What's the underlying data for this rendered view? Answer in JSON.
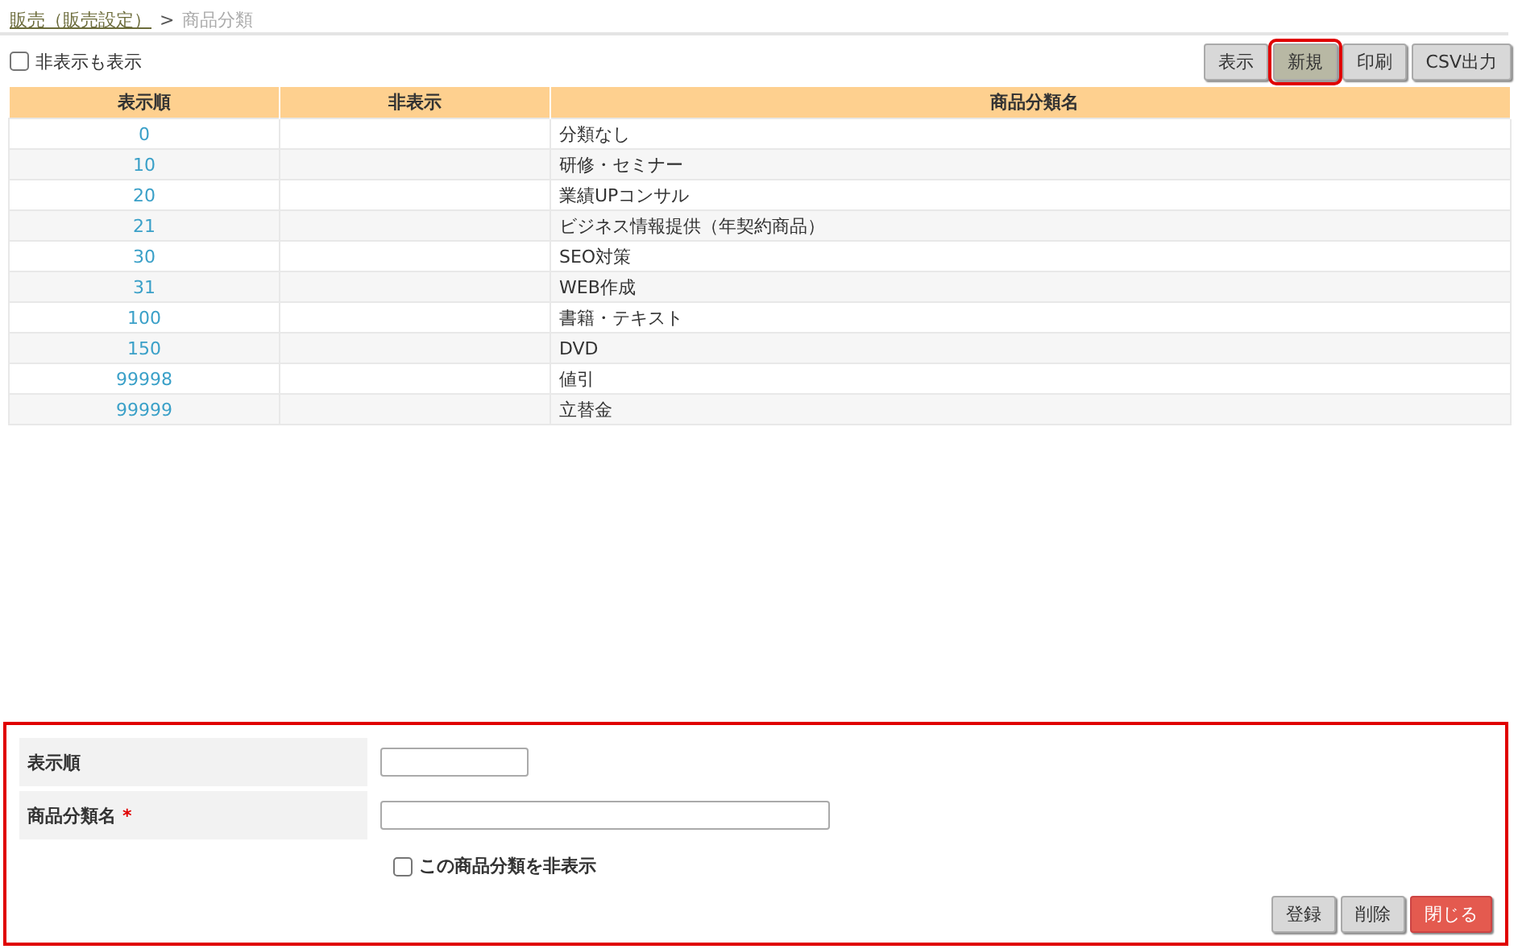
{
  "breadcrumb": {
    "parent": "販売（販売設定）",
    "separator": ">",
    "current": "商品分類"
  },
  "show_hidden": {
    "label": "非表示も表示",
    "checked": false
  },
  "toolbar": [
    {
      "label": "表示",
      "highlighted": false
    },
    {
      "label": "新規",
      "highlighted": true
    },
    {
      "label": "印刷",
      "highlighted": false
    },
    {
      "label": "CSV出力",
      "highlighted": false
    }
  ],
  "table": {
    "columns": [
      "表示順",
      "非表示",
      "商品分類名"
    ],
    "rows": [
      {
        "order": "0",
        "name": "分類なし"
      },
      {
        "order": "10",
        "name": "研修・セミナー"
      },
      {
        "order": "20",
        "name": "業績UPコンサル"
      },
      {
        "order": "21",
        "name": "ビジネス情報提供（年契約商品）"
      },
      {
        "order": "30",
        "name": "SEO対策"
      },
      {
        "order": "31",
        "name": "WEB作成"
      },
      {
        "order": "100",
        "name": "書籍・テキスト"
      },
      {
        "order": "150",
        "name": "DVD"
      },
      {
        "order": "99998",
        "name": "値引"
      },
      {
        "order": "99999",
        "name": "立替金"
      }
    ]
  },
  "form": {
    "highlighted": true,
    "fields": [
      {
        "label": "表示順",
        "kind": "short"
      },
      {
        "label": "商品分類名",
        "required_mark": "*",
        "kind": "long"
      }
    ],
    "hide_checkbox": {
      "label": "この商品分類を非表示",
      "checked": false
    },
    "buttons": [
      {
        "label": "登録",
        "kind": "normal"
      },
      {
        "label": "削除",
        "kind": "normal"
      },
      {
        "label": "閉じる",
        "kind": "danger"
      }
    ]
  }
}
